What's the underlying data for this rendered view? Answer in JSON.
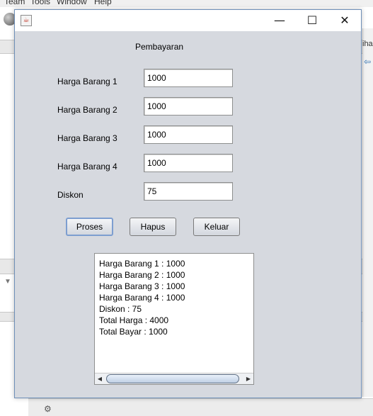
{
  "background": {
    "menu": [
      "Team",
      "Tools",
      "Window",
      "Help"
    ],
    "right_text": "ihan"
  },
  "window": {
    "icon": "java-cup-icon",
    "controls": {
      "minimize": "—",
      "maximize": "☐",
      "close": "✕"
    }
  },
  "form": {
    "heading": "Pembayaran",
    "fields": [
      {
        "label": "Harga Barang 1",
        "value": "1000"
      },
      {
        "label": "Harga Barang 2",
        "value": "1000"
      },
      {
        "label": "Harga Barang 3",
        "value": "1000"
      },
      {
        "label": "Harga Barang 4",
        "value": "1000"
      },
      {
        "label": "Diskon",
        "value": "75"
      }
    ],
    "buttons": {
      "proses": "Proses",
      "hapus": "Hapus",
      "keluar": "Keluar"
    }
  },
  "output": {
    "lines": [
      "Harga Barang 1 : 1000",
      "Harga Barang 2 : 1000",
      "Harga Barang 3 : 1000",
      "Harga Barang 4 : 1000",
      "Diskon : 75",
      "Total Harga : 4000",
      "Total Bayar : 1000"
    ]
  },
  "colors": {
    "window_bg": "#d6d9df",
    "focus_border": "#7d9ed0",
    "window_border": "#6e8fb8"
  }
}
